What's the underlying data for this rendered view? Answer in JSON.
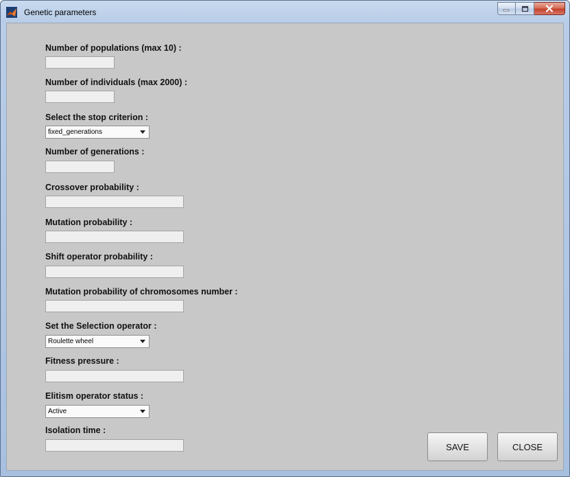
{
  "window": {
    "title": "Genetic parameters",
    "controls": [
      "minimize-icon",
      "maximize-icon",
      "close-icon"
    ]
  },
  "form": {
    "populations_label": "Number of populations (max 10) :",
    "populations_value": "",
    "individuals_label": "Number of individuals (max 2000) :",
    "individuals_value": "",
    "stop_criterion_label": "Select the stop criterion :",
    "stop_criterion_value": "fixed_generations",
    "generations_label": "Number of generations :",
    "generations_value": "",
    "crossover_label": "Crossover probability :",
    "crossover_value": "",
    "mutation_label": "Mutation probability :",
    "mutation_value": "",
    "shift_label": "Shift operator probability :",
    "shift_value": "",
    "chromosome_mutation_label": "Mutation probability of chromosomes number :",
    "chromosome_mutation_value": "",
    "selection_label": "Set the Selection operator :",
    "selection_value": "Roulette wheel",
    "fitness_label": "Fitness pressure :",
    "fitness_value": "",
    "elitism_label": "Elitism operator status :",
    "elitism_value": "Active",
    "isolation_label": "Isolation time :",
    "isolation_value": ""
  },
  "buttons": {
    "save": "SAVE",
    "close": "CLOSE"
  },
  "colors": {
    "panel_background": "#c8c8c8",
    "field_background": "#efefef",
    "close_button": "#c3412a"
  }
}
